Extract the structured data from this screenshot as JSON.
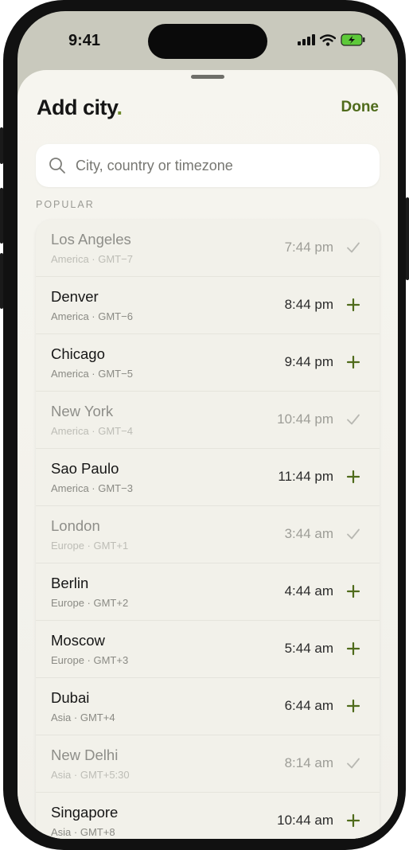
{
  "status": {
    "time": "9:41"
  },
  "header": {
    "title": "Add city",
    "title_dot": ".",
    "done_label": "Done"
  },
  "search": {
    "placeholder": "City, country or timezone"
  },
  "section_label": "POPULAR",
  "colors": {
    "accent": "#4f6b1b",
    "added": "#b8b8b2"
  },
  "cities": [
    {
      "name": "Los Angeles",
      "region": "America · GMT−7",
      "time": "7:44 pm",
      "added": true
    },
    {
      "name": "Denver",
      "region": "America · GMT−6",
      "time": "8:44 pm",
      "added": false
    },
    {
      "name": "Chicago",
      "region": "America · GMT−5",
      "time": "9:44 pm",
      "added": false
    },
    {
      "name": "New York",
      "region": "America · GMT−4",
      "time": "10:44 pm",
      "added": true
    },
    {
      "name": "Sao Paulo",
      "region": "America · GMT−3",
      "time": "11:44 pm",
      "added": false
    },
    {
      "name": "London",
      "region": "Europe · GMT+1",
      "time": "3:44 am",
      "added": true
    },
    {
      "name": "Berlin",
      "region": "Europe · GMT+2",
      "time": "4:44 am",
      "added": false
    },
    {
      "name": "Moscow",
      "region": "Europe · GMT+3",
      "time": "5:44 am",
      "added": false
    },
    {
      "name": "Dubai",
      "region": "Asia · GMT+4",
      "time": "6:44 am",
      "added": false
    },
    {
      "name": "New Delhi",
      "region": "Asia · GMT+5:30",
      "time": "8:14 am",
      "added": true
    },
    {
      "name": "Singapore",
      "region": "Asia · GMT+8",
      "time": "10:44 am",
      "added": false
    }
  ]
}
